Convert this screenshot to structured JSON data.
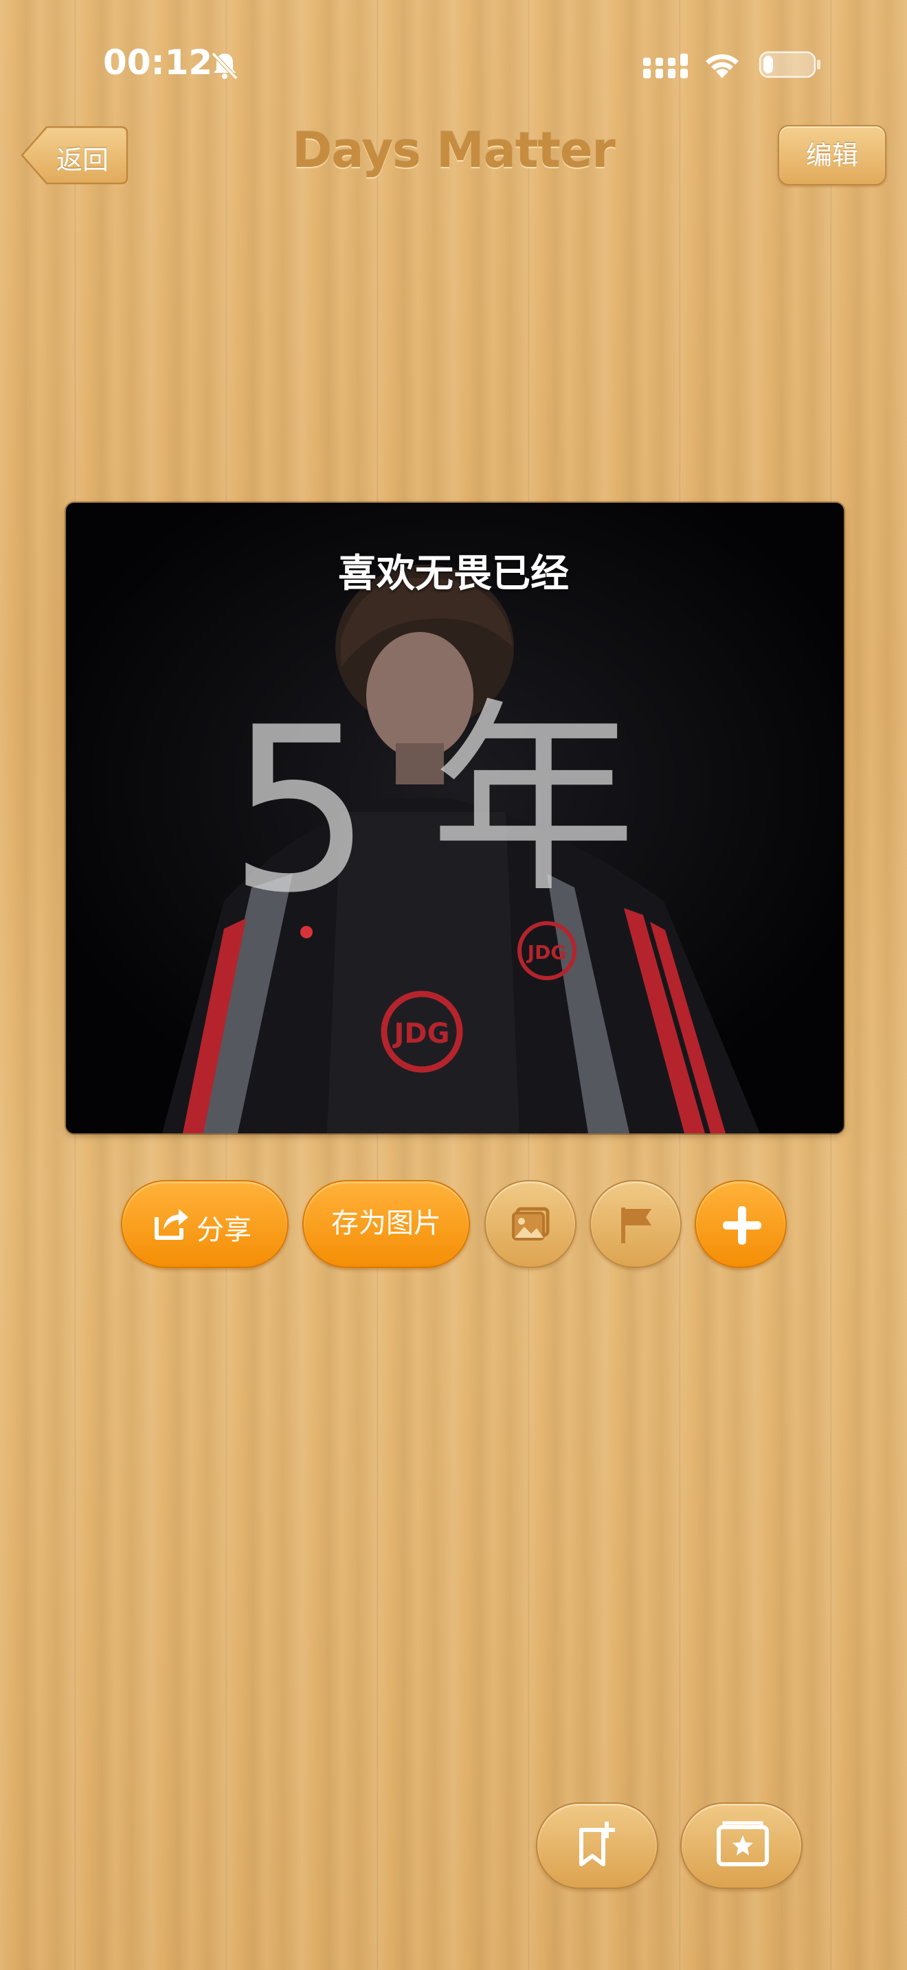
{
  "status_bar": {
    "time": "00:12",
    "silent_icon": "bell-slash-icon",
    "signal_icon": "cellular-signal-icon",
    "wifi_icon": "wifi-icon",
    "battery_icon": "battery-low-icon",
    "battery_level": 0.2
  },
  "nav": {
    "back_label": "返回",
    "title": "Days Matter",
    "edit_label": "编辑"
  },
  "card": {
    "title": "喜欢无畏已经",
    "number": "5",
    "unit": "年"
  },
  "actions": {
    "share_label": "分享",
    "save_image_label": "存为图片",
    "share_icon": "share-icon",
    "photo_icon": "photo-icon",
    "flag_icon": "flag-icon",
    "add_icon": "plus-icon"
  },
  "bottom": {
    "bookmark_icon": "bookmark-add-icon",
    "gallery_icon": "photo-gallery-icon"
  },
  "colors": {
    "accent_orange": "#f89a12",
    "wood": "#e3b46c",
    "title_brown": "#c68d41"
  }
}
